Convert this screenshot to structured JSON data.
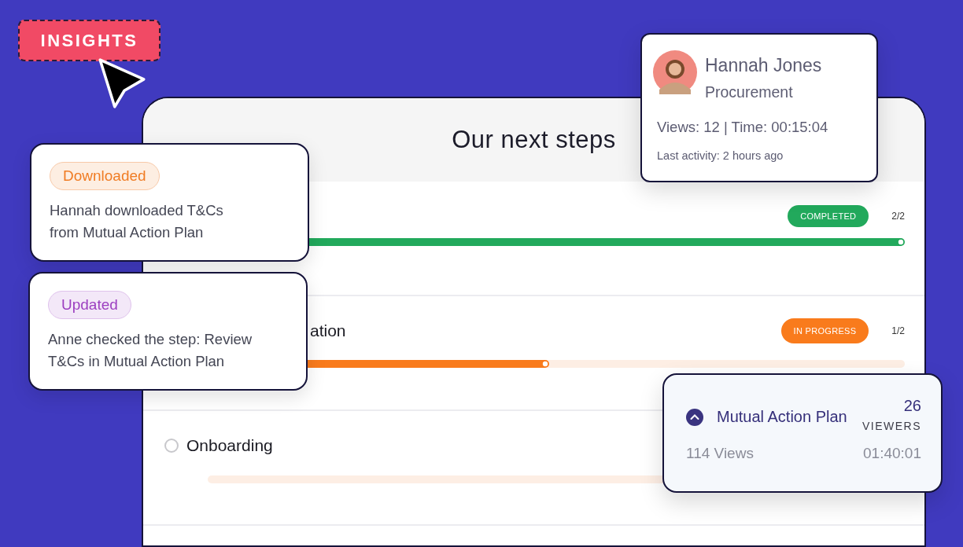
{
  "badge": {
    "label": "INSIGHTS"
  },
  "panel": {
    "title": "Our next steps"
  },
  "steps": [
    {
      "kind": "completed",
      "status": "COMPLETED",
      "count": "2/2",
      "level": 1
    },
    {
      "kind": "in_progress",
      "title": "ation",
      "status": "IN PROGRESS",
      "count": "1/2",
      "level": 0.49
    },
    {
      "kind": "not_started",
      "title": "Onboarding",
      "checked": false
    }
  ],
  "activity": [
    {
      "kind": "downloaded",
      "tag": "Downloaded",
      "lines": [
        "Hannah downloaded T&Cs",
        "from Mutual Action Plan"
      ]
    },
    {
      "kind": "updated",
      "tag": "Updated",
      "lines": [
        "Anne checked the step: Review",
        "T&Cs in Mutual Action Plan"
      ]
    }
  ],
  "contact": {
    "name": "Hannah Jones",
    "department": "Procurement",
    "stats": "Views: 12 | Time: 00:15:04",
    "last_activity": "Last activity: 2 hours ago"
  },
  "document": {
    "title": "Mutual Action Plan",
    "expanded": true,
    "viewers": "26",
    "viewers_label": "VIEWERS",
    "views": "114 Views",
    "time": "01:40:01"
  }
}
